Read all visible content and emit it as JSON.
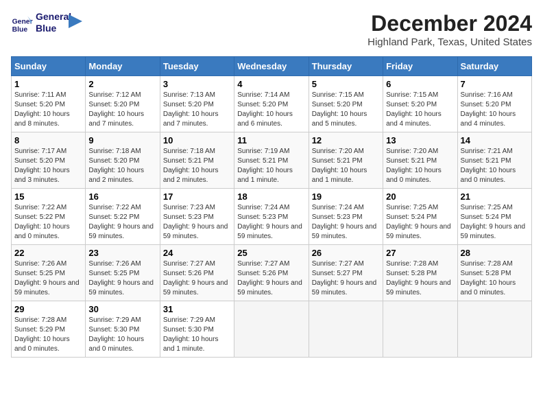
{
  "header": {
    "logo_line1": "General",
    "logo_line2": "Blue",
    "main_title": "December 2024",
    "subtitle": "Highland Park, Texas, United States"
  },
  "calendar": {
    "days_of_week": [
      "Sunday",
      "Monday",
      "Tuesday",
      "Wednesday",
      "Thursday",
      "Friday",
      "Saturday"
    ],
    "weeks": [
      [
        {
          "day": "",
          "empty": true
        },
        {
          "day": "",
          "empty": true
        },
        {
          "day": "",
          "empty": true
        },
        {
          "day": "",
          "empty": true
        },
        {
          "day": "",
          "empty": true
        },
        {
          "day": "",
          "empty": true
        },
        {
          "day": "",
          "empty": true
        }
      ],
      [
        {
          "day": "1",
          "sunrise": "7:11 AM",
          "sunset": "5:20 PM",
          "daylight": "10 hours and 8 minutes."
        },
        {
          "day": "2",
          "sunrise": "7:12 AM",
          "sunset": "5:20 PM",
          "daylight": "10 hours and 7 minutes."
        },
        {
          "day": "3",
          "sunrise": "7:13 AM",
          "sunset": "5:20 PM",
          "daylight": "10 hours and 7 minutes."
        },
        {
          "day": "4",
          "sunrise": "7:14 AM",
          "sunset": "5:20 PM",
          "daylight": "10 hours and 6 minutes."
        },
        {
          "day": "5",
          "sunrise": "7:15 AM",
          "sunset": "5:20 PM",
          "daylight": "10 hours and 5 minutes."
        },
        {
          "day": "6",
          "sunrise": "7:15 AM",
          "sunset": "5:20 PM",
          "daylight": "10 hours and 4 minutes."
        },
        {
          "day": "7",
          "sunrise": "7:16 AM",
          "sunset": "5:20 PM",
          "daylight": "10 hours and 4 minutes."
        }
      ],
      [
        {
          "day": "8",
          "sunrise": "7:17 AM",
          "sunset": "5:20 PM",
          "daylight": "10 hours and 3 minutes."
        },
        {
          "day": "9",
          "sunrise": "7:18 AM",
          "sunset": "5:20 PM",
          "daylight": "10 hours and 2 minutes."
        },
        {
          "day": "10",
          "sunrise": "7:18 AM",
          "sunset": "5:21 PM",
          "daylight": "10 hours and 2 minutes."
        },
        {
          "day": "11",
          "sunrise": "7:19 AM",
          "sunset": "5:21 PM",
          "daylight": "10 hours and 1 minute."
        },
        {
          "day": "12",
          "sunrise": "7:20 AM",
          "sunset": "5:21 PM",
          "daylight": "10 hours and 1 minute."
        },
        {
          "day": "13",
          "sunrise": "7:20 AM",
          "sunset": "5:21 PM",
          "daylight": "10 hours and 0 minutes."
        },
        {
          "day": "14",
          "sunrise": "7:21 AM",
          "sunset": "5:21 PM",
          "daylight": "10 hours and 0 minutes."
        }
      ],
      [
        {
          "day": "15",
          "sunrise": "7:22 AM",
          "sunset": "5:22 PM",
          "daylight": "10 hours and 0 minutes."
        },
        {
          "day": "16",
          "sunrise": "7:22 AM",
          "sunset": "5:22 PM",
          "daylight": "9 hours and 59 minutes."
        },
        {
          "day": "17",
          "sunrise": "7:23 AM",
          "sunset": "5:23 PM",
          "daylight": "9 hours and 59 minutes."
        },
        {
          "day": "18",
          "sunrise": "7:24 AM",
          "sunset": "5:23 PM",
          "daylight": "9 hours and 59 minutes."
        },
        {
          "day": "19",
          "sunrise": "7:24 AM",
          "sunset": "5:23 PM",
          "daylight": "9 hours and 59 minutes."
        },
        {
          "day": "20",
          "sunrise": "7:25 AM",
          "sunset": "5:24 PM",
          "daylight": "9 hours and 59 minutes."
        },
        {
          "day": "21",
          "sunrise": "7:25 AM",
          "sunset": "5:24 PM",
          "daylight": "9 hours and 59 minutes."
        }
      ],
      [
        {
          "day": "22",
          "sunrise": "7:26 AM",
          "sunset": "5:25 PM",
          "daylight": "9 hours and 59 minutes."
        },
        {
          "day": "23",
          "sunrise": "7:26 AM",
          "sunset": "5:25 PM",
          "daylight": "9 hours and 59 minutes."
        },
        {
          "day": "24",
          "sunrise": "7:27 AM",
          "sunset": "5:26 PM",
          "daylight": "9 hours and 59 minutes."
        },
        {
          "day": "25",
          "sunrise": "7:27 AM",
          "sunset": "5:26 PM",
          "daylight": "9 hours and 59 minutes."
        },
        {
          "day": "26",
          "sunrise": "7:27 AM",
          "sunset": "5:27 PM",
          "daylight": "9 hours and 59 minutes."
        },
        {
          "day": "27",
          "sunrise": "7:28 AM",
          "sunset": "5:28 PM",
          "daylight": "9 hours and 59 minutes."
        },
        {
          "day": "28",
          "sunrise": "7:28 AM",
          "sunset": "5:28 PM",
          "daylight": "10 hours and 0 minutes."
        }
      ],
      [
        {
          "day": "29",
          "sunrise": "7:28 AM",
          "sunset": "5:29 PM",
          "daylight": "10 hours and 0 minutes."
        },
        {
          "day": "30",
          "sunrise": "7:29 AM",
          "sunset": "5:30 PM",
          "daylight": "10 hours and 0 minutes."
        },
        {
          "day": "31",
          "sunrise": "7:29 AM",
          "sunset": "5:30 PM",
          "daylight": "10 hours and 1 minute."
        },
        {
          "day": "",
          "empty": true
        },
        {
          "day": "",
          "empty": true
        },
        {
          "day": "",
          "empty": true
        },
        {
          "day": "",
          "empty": true
        }
      ]
    ]
  }
}
